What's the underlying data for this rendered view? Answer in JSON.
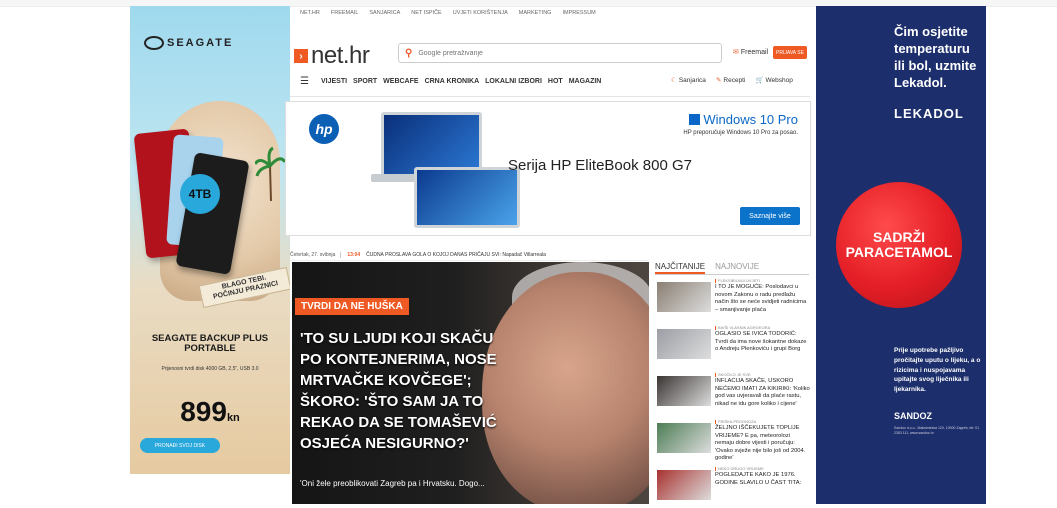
{
  "topnav": [
    "NET.HR",
    "FREEMAIL",
    "SANJARICA",
    "NET ISPIČE",
    "UVJETI KORIŠTENJA",
    "MARKETING",
    "IMPRESSUM"
  ],
  "header": {
    "logo": "net.hr",
    "search_placeholder": "Google pretraživanje",
    "freemail": "Freemail",
    "prijava": "PRIJAVA SE"
  },
  "mainnav": [
    "VIJESTI",
    "SPORT",
    "WEBCAFE",
    "CRNA KRONIKA",
    "LOKALNI IZBORI",
    "HOT",
    "MAGAZIN"
  ],
  "rightnav": [
    {
      "icon": "sanjarica-icon",
      "glyph": "☾",
      "label": "Sanjarica"
    },
    {
      "icon": "recepti-icon",
      "glyph": "✎",
      "label": "Recepti"
    },
    {
      "icon": "cart-icon",
      "glyph": "🛒",
      "label": "Webshop"
    }
  ],
  "left_ad": {
    "brand": "SEAGATE",
    "badge": "4TB",
    "sign": "BLAGO TEBI. POČINJU PRAZNICI",
    "title": "SEAGATE BACKUP PLUS PORTABLE",
    "spec": "Prijenosni tvrdi disk 4000 GB, 2,5\", USB 3.0",
    "price": "899",
    "currency": "kn",
    "cta": "PRONAĐI SVOJ DISK"
  },
  "hp_banner": {
    "logo": "hp",
    "windows": "Windows 10 Pro",
    "tagline": "HP preporučuje Windows 10 Pro za posao.",
    "series": "Serija HP EliteBook 800 G7",
    "cta": "Saznajte više"
  },
  "ticker": {
    "date": "Četvrtak, 27. svibnja",
    "time": "13:04",
    "text": "ČUDNA PROSLAVA GOLA O KOJOJ DANAS PRIČAJU SVI: Napadač Villarreala"
  },
  "hero": {
    "label": "TVRDI DA NE HUŠKA",
    "title": "'TO SU LJUDI KOJI SKAČU PO KONTEJNERIMA, NOSE MRTVAČKE KOVČEGE'; ŠKORO: 'ŠTO SAM JA TO REKAO DA SE TOMAŠEVIĆ OSJEĆA NESIGURNO?'",
    "sub": "'Oni žele preoblikovati Zagreb pa i Hrvatsku. Dogo..."
  },
  "tabs": {
    "active": "NAJČITANIJE",
    "other": "NAJNOVIJE"
  },
  "sidebar": [
    {
      "cat": "FLEKSIBILNIJI UVJETI",
      "text": "I TO JE MOGUĆE: Poslodavci u novom Zakonu o radu predlažu način što se neće svidjeti radnicima – smanjivanje plaća",
      "color": "#8a7f73"
    },
    {
      "cat": "BIVŠI VLASNIK AGROKORA",
      "text": "OGLASIO SE IVICA TODORIĆ: Tvrdi da ima nove šokantne dokaze o Andreju Plenkoviću i grupi Borg",
      "color": "#9b9ea5"
    },
    {
      "cat": "SKOČILO JE SVE",
      "text": "INFLACIJA SKAČE, USKORO NEĆEMO IMATI ZA KIKIRIKI: 'Koliko god vas uvjeravali da plaće rastu, nikad ne idu gore koliko i cijene'",
      "color": "#3a3533"
    },
    {
      "cat": "FRIŠKA PROGNOZA",
      "text": "ŽELJNO IŠČEKUJETE TOPLIJE VRIJEME? E pa, meteorolozi nemaju dobre vijesti i poručuju: 'Ovako svježe nije bilo još od 2004. godine'",
      "color": "#4c7d55"
    },
    {
      "cat": "NEKO DRUGO VRIJEME",
      "text": "POGLEDAJTE KAKO JE 1976. GODINE SLAVILO U ČAST TITA:",
      "color": "#a8322f"
    }
  ],
  "right_ad": {
    "head": "Čim osjetite temperaturu ili bol, uzmite Lekadol.",
    "logo": "LEKADOL",
    "pill": "SADRŽI PARACETAMOL",
    "warn": "Prije upotrebe pažljivo pročitajte uputu o lijeku, a o rizicima i nuspojavama upitajte svog liječnika ili ljekarnika.",
    "sandoz": "SANDOZ",
    "addr": "Sandoz d.o.o., Maksimirska 120, 10000 Zagreb, tel: 01 2353 111, www.sandoz.hr"
  }
}
